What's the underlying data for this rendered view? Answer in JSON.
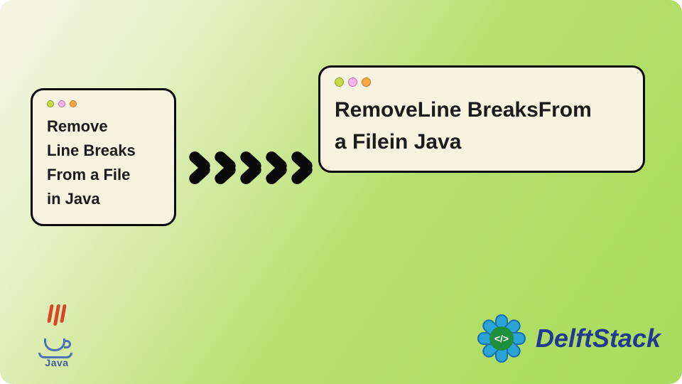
{
  "left_card": {
    "line1": "Remove",
    "line2": "Line Breaks",
    "line3": "From a File",
    "line4": "in Java"
  },
  "right_card": {
    "line1": "RemoveLine BreaksFrom",
    "line2": "a Filein Java"
  },
  "logos": {
    "java_label": "Java",
    "delft_name": "DelftStack",
    "delft_badge": "</>"
  }
}
